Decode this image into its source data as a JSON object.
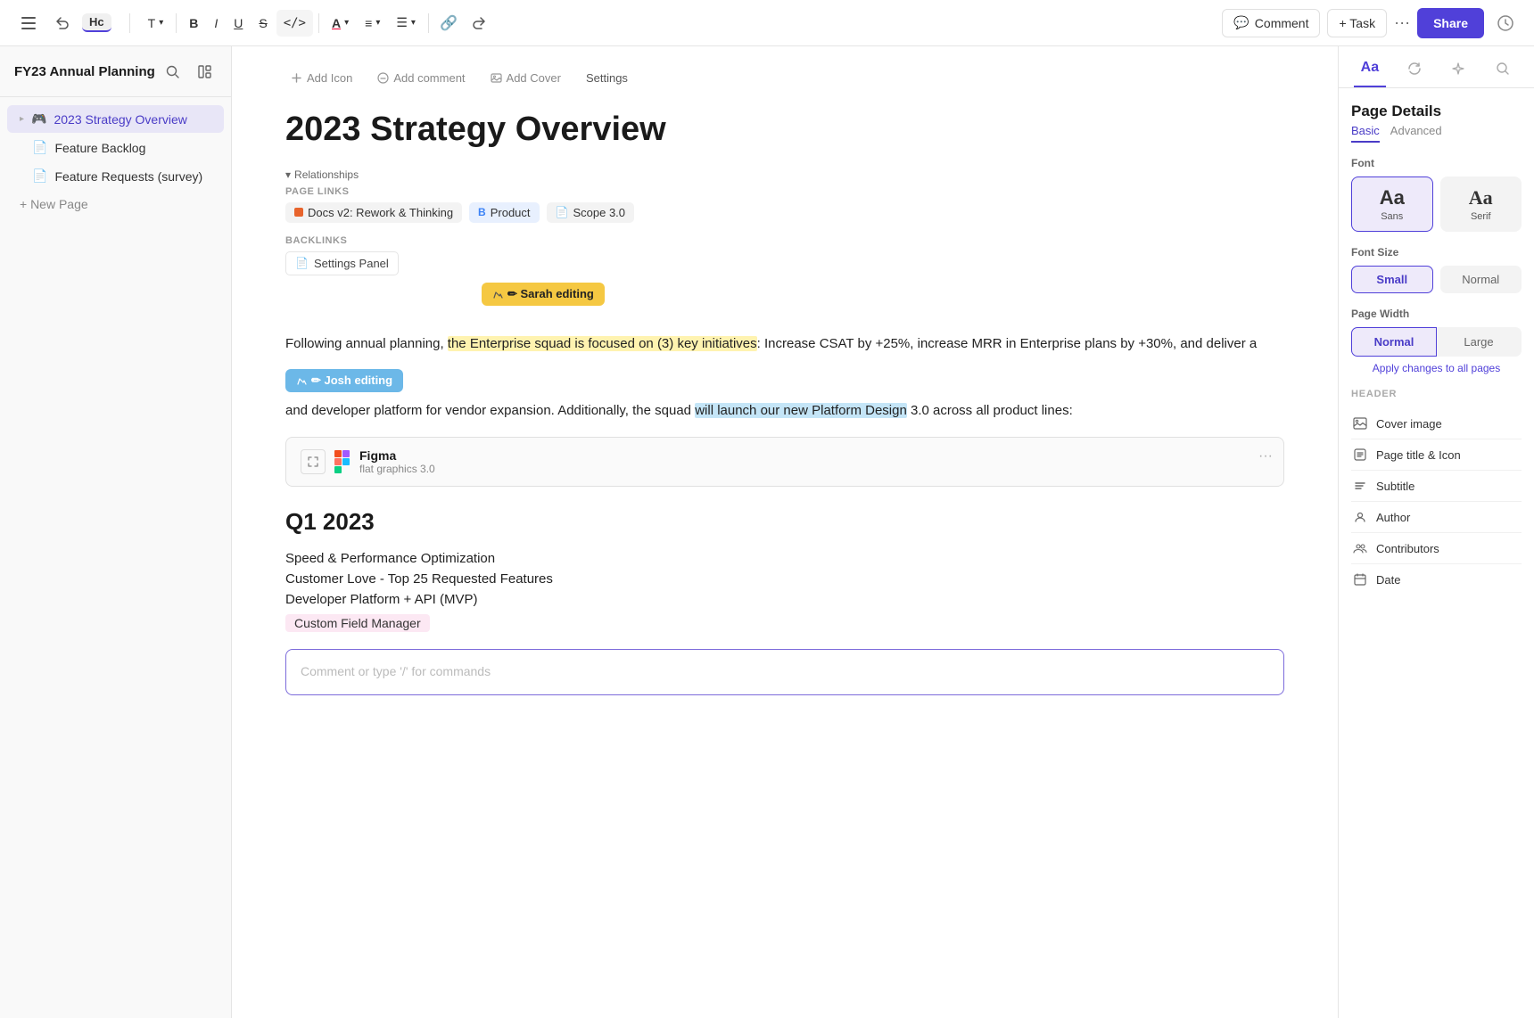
{
  "toolbar": {
    "undo_label": "↩",
    "breadcrumb": "Hc",
    "text_btn": "T",
    "bold_btn": "B",
    "italic_btn": "I",
    "underline_btn": "U",
    "strike_btn": "S",
    "code_btn": "</>",
    "font_color_btn": "A",
    "align_btn": "≡",
    "list_btn": "☰",
    "link_btn": "🔗",
    "undo2_btn": "↩",
    "comment_btn": "Comment",
    "task_btn": "+ Task",
    "more_btn": "···",
    "share_btn": "Share",
    "history_icon": "🕐"
  },
  "sidebar": {
    "workspace_title": "FY23 Annual Planning",
    "items": [
      {
        "id": "strategy",
        "label": "2023 Strategy Overview",
        "icon": "🎮",
        "active": true,
        "has_arrow": true
      },
      {
        "id": "backlog",
        "label": "Feature Backlog",
        "icon": "📄",
        "active": false
      },
      {
        "id": "requests",
        "label": "Feature Requests (survey)",
        "icon": "📄",
        "active": false
      }
    ],
    "new_page_label": "+ New Page"
  },
  "page": {
    "meta_add_icon": "⊕ Add Icon",
    "meta_add_comment": "💬 Add comment",
    "meta_add_cover": "🖼 Add Cover",
    "meta_settings": "Settings",
    "title": "2023 Strategy Overview",
    "relationships_toggle": "▾ Relationships",
    "page_links_label": "PAGE LINKS",
    "page_links": [
      {
        "id": "docs",
        "label": "Docs v2: Rework & Thinking",
        "color": "orange"
      },
      {
        "id": "product",
        "label": "Product",
        "color": "blue"
      },
      {
        "id": "scope",
        "label": "Scope 3.0",
        "color": "none"
      }
    ],
    "backlinks_label": "BACKLINKS",
    "backlink": "Settings Panel",
    "sarah_badge": "✏ Sarah editing",
    "josh_badge": "✏ Josh editing",
    "body_text_1": "Following annual planning, ",
    "body_highlight_1": "the Enterprise squad is focused on (3) key initiatives",
    "body_text_2": ": Increase CSAT by +25%, increase MRR in Enterprise plans by +30%, and deliver a",
    "body_text_3": " and developer platform for vendor expansion. Additionally, the squad",
    "body_highlight_2": "will launch our new Platform Design",
    "body_text_4": " 3.0 across all product lines:",
    "figma_name": "Figma",
    "figma_sub": "flat graphics 3.0",
    "q1_heading": "Q1 2023",
    "q1_items": [
      "Speed & Performance Optimization",
      "Customer Love - Top 25 Requested Features",
      "Developer Platform + API (MVP)",
      "Custom Field Manager"
    ],
    "comment_placeholder": "Comment or type '/' for commands"
  },
  "right_panel": {
    "section_title": "Page Details",
    "tab_basic": "Basic",
    "tab_advanced": "Advanced",
    "font_label": "Font",
    "font_options": [
      {
        "id": "sans",
        "preview": "Aa",
        "name": "Sans",
        "active": true
      },
      {
        "id": "serif",
        "preview": "Aa",
        "name": "Serif",
        "active": false
      }
    ],
    "font_size_label": "Font Size",
    "font_sizes": [
      {
        "id": "small",
        "label": "Small",
        "active": true
      },
      {
        "id": "normal",
        "label": "Normal",
        "active": false
      }
    ],
    "page_width_label": "Page Width",
    "page_widths": [
      {
        "id": "normal",
        "label": "Normal",
        "active": true
      },
      {
        "id": "large",
        "label": "Large",
        "active": false
      }
    ],
    "apply_link": "Apply changes to all pages",
    "header_label": "HEADER",
    "header_options": [
      {
        "id": "cover",
        "label": "Cover image",
        "icon": "🖼"
      },
      {
        "id": "page-title-icon",
        "label": "Page title & Icon",
        "icon": "T"
      },
      {
        "id": "subtitle",
        "label": "Subtitle",
        "icon": "T̲"
      },
      {
        "id": "author",
        "label": "Author",
        "icon": "👤"
      },
      {
        "id": "contributors",
        "label": "Contributors",
        "icon": "👥"
      },
      {
        "id": "date",
        "label": "Date",
        "icon": "📅"
      }
    ]
  }
}
